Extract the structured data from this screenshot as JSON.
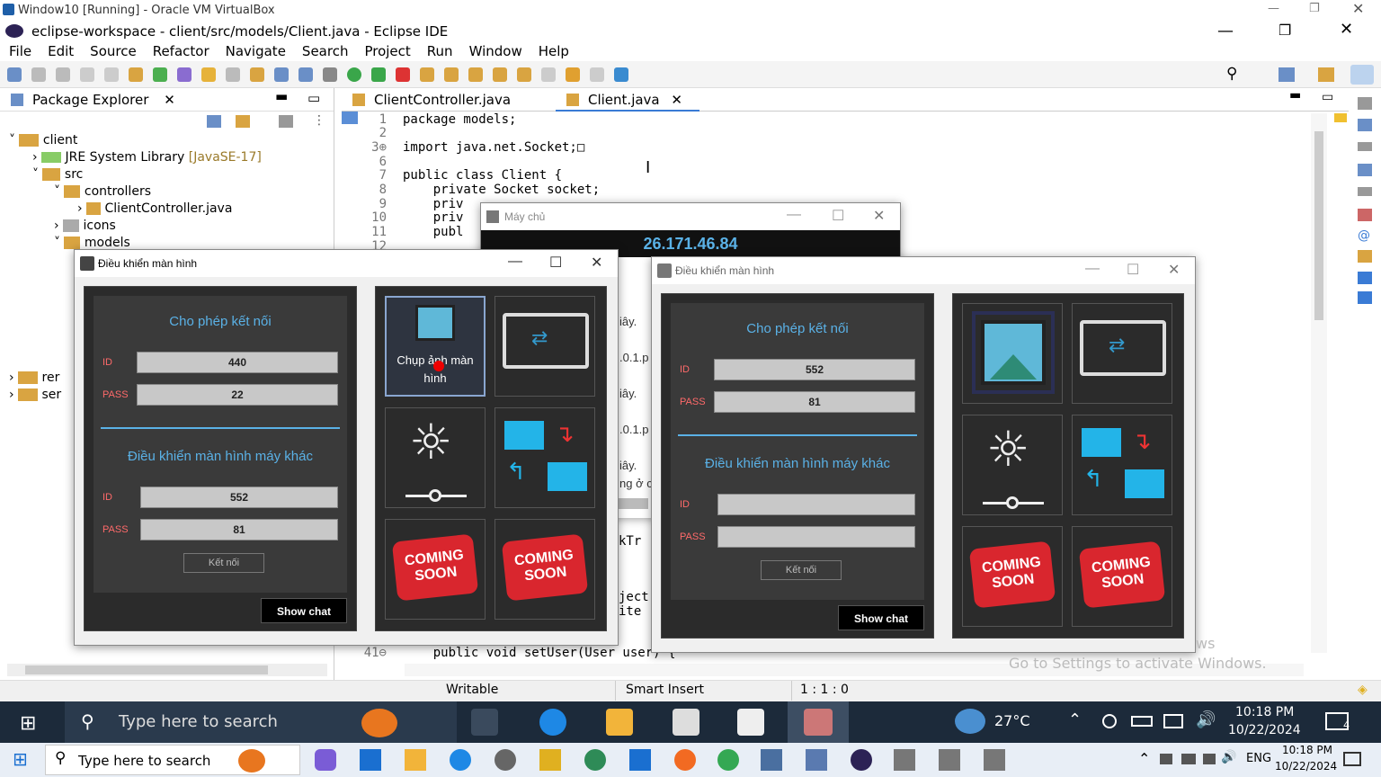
{
  "vbox": {
    "title": "Window10 [Running] - Oracle VM VirtualBox"
  },
  "eclipse": {
    "title": "eclipse-workspace - client/src/models/Client.java - Eclipse IDE",
    "menu": [
      "File",
      "Edit",
      "Source",
      "Refactor",
      "Navigate",
      "Search",
      "Project",
      "Run",
      "Window",
      "Help"
    ]
  },
  "explorer": {
    "title": "Package Explorer",
    "tree": [
      "client",
      "JRE System Library",
      "[JavaSE-17]",
      "src",
      "controllers",
      "ClientController.java",
      "icons",
      "models",
      "rer",
      "ser"
    ]
  },
  "editor": {
    "tabs": [
      "ClientController.java",
      "Client.java"
    ],
    "lines": [
      {
        "n": "1",
        "code": "package models;"
      },
      {
        "n": "2",
        "code": ""
      },
      {
        "n": "3⊕",
        "code": "import java.net.Socket;□"
      },
      {
        "n": "6",
        "code": ""
      },
      {
        "n": "7",
        "code": "public class Client {"
      },
      {
        "n": "8",
        "code": "    private Socket socket;"
      },
      {
        "n": "9",
        "code": "    priv"
      },
      {
        "n": "10",
        "code": "    priv"
      },
      {
        "n": "11",
        "code": "    publ"
      },
      {
        "n": "12",
        "code": ""
      }
    ],
    "line41": "41⊖",
    "code41": "    public void setUser(User user) {"
  },
  "server": {
    "title": "Máy chủ",
    "ip": "26.171.46.84",
    "frag": [
      "iây.",
      ".0.1.p",
      "iây.",
      ".0.1.p",
      "iây.",
      "ng ở c",
      "kTr",
      "ject",
      "ite"
    ]
  },
  "left_win": {
    "title": "Điều khiển màn hình",
    "allow": "Cho phép kết nối",
    "id_label": "ID",
    "pass_label": "PASS",
    "id": "440",
    "pass": "22",
    "other": "Điều khiển màn hình máy khác",
    "oid": "552",
    "opass": "81",
    "connect": "Kết nối",
    "show_chat": "Show chat",
    "capture": "Chụp ảnh màn hình",
    "coming": "COMING SOON"
  },
  "right_win": {
    "title": "Điều khiển màn hình",
    "allow": "Cho phép kết nối",
    "id_label": "ID",
    "pass_label": "PASS",
    "id": "552",
    "pass": "81",
    "other": "Điều khiển màn hình máy khác",
    "oid": "",
    "opass": "",
    "connect": "Kết nối",
    "show_chat": "Show chat",
    "coming": "COMING SOON"
  },
  "status": {
    "writable": "Writable",
    "insert": "Smart Insert",
    "pos": "1 : 1 : 0"
  },
  "watermark": {
    "line1": "ws",
    "line2": "Go to Settings to activate Windows."
  },
  "taskbar_vm": {
    "search": "Type here to search",
    "temp": "27°C",
    "time": "10:18 PM",
    "date": "10/22/2024",
    "notif": "4"
  },
  "taskbar_host": {
    "search": "Type here to search",
    "lang": "ENG",
    "time": "10:18 PM",
    "date": "10/22/2024"
  }
}
